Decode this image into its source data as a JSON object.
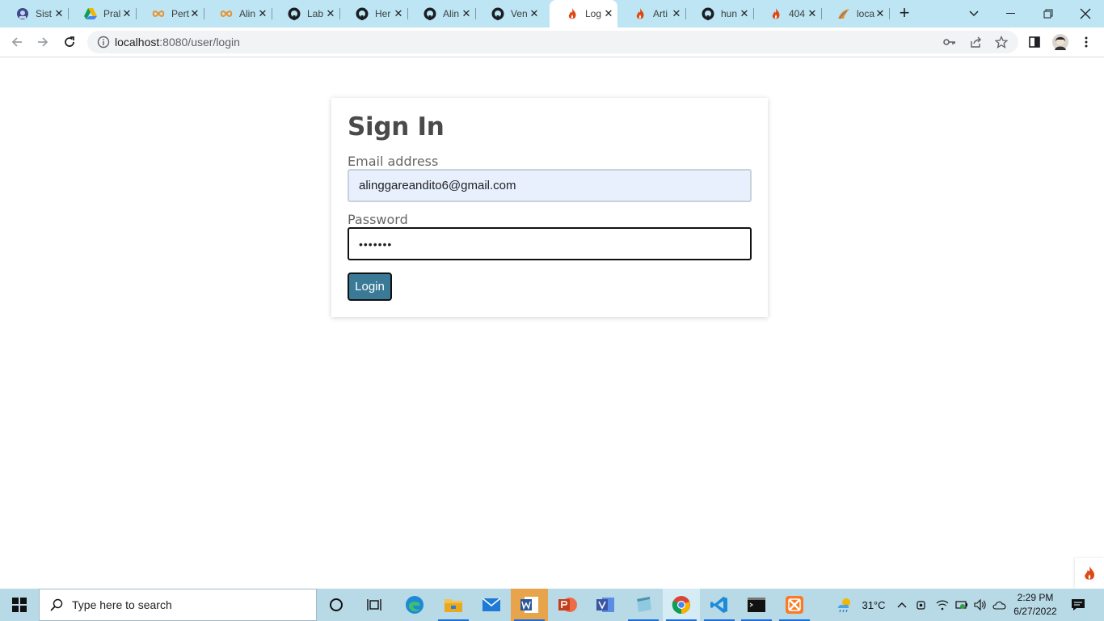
{
  "browser": {
    "tabs": [
      {
        "title": "Sist",
        "icon": "app-icon",
        "active": false
      },
      {
        "title": "Pral",
        "icon": "google-drive-icon",
        "active": false
      },
      {
        "title": "Pert",
        "icon": "infinity-icon",
        "active": false
      },
      {
        "title": "Alin",
        "icon": "infinity-icon",
        "active": false
      },
      {
        "title": "Lab",
        "icon": "github-icon",
        "active": false
      },
      {
        "title": "Her",
        "icon": "github-icon",
        "active": false
      },
      {
        "title": "Alin",
        "icon": "github-icon",
        "active": false
      },
      {
        "title": "Ven",
        "icon": "github-icon",
        "active": false
      },
      {
        "title": "Log",
        "icon": "codeigniter-flame-icon",
        "active": true
      },
      {
        "title": "Arti",
        "icon": "codeigniter-flame-icon",
        "active": false
      },
      {
        "title": "hun",
        "icon": "github-icon",
        "active": false
      },
      {
        "title": "404",
        "icon": "codeigniter-flame-icon",
        "active": false
      },
      {
        "title": "loca",
        "icon": "phpmyadmin-icon",
        "active": false
      }
    ],
    "url_host": "localhost",
    "url_path": ":8080/user/login"
  },
  "page": {
    "heading": "Sign In",
    "email_label": "Email address",
    "email_value": "alinggareandito6@gmail.com",
    "password_label": "Password",
    "password_value": "•••••••",
    "login_button": "Login"
  },
  "taskbar": {
    "search_placeholder": "Type here to search",
    "temperature": "31°C",
    "time": "2:29 PM",
    "date": "6/27/2022"
  },
  "colors": {
    "tabstrip": "#bde5f3",
    "login_button": "#3a7a97",
    "email_autofill": "#e8f0fe",
    "taskbar": "#b8d9e6"
  }
}
